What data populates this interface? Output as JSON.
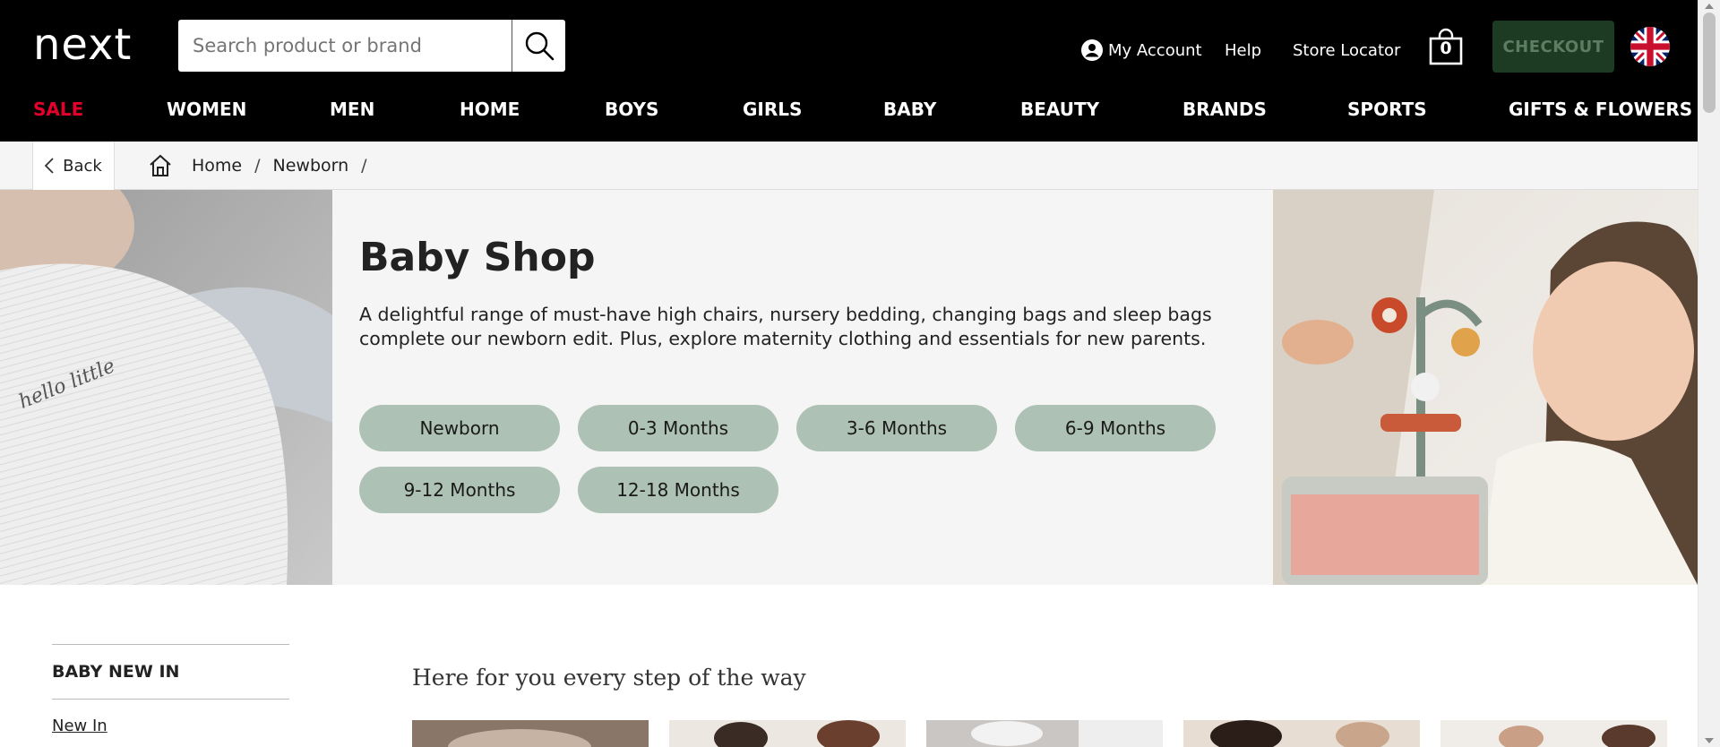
{
  "header": {
    "logo_text": "next",
    "search": {
      "placeholder": "Search product or brand",
      "value": ""
    },
    "account_label": "My Account",
    "help_label": "Help",
    "store_locator_label": "Store Locator",
    "bag_count": "0",
    "checkout_label": "CHECKOUT"
  },
  "nav": {
    "items": [
      {
        "label": "SALE"
      },
      {
        "label": "WOMEN"
      },
      {
        "label": "MEN"
      },
      {
        "label": "HOME"
      },
      {
        "label": "BOYS"
      },
      {
        "label": "GIRLS"
      },
      {
        "label": "BABY"
      },
      {
        "label": "BEAUTY"
      },
      {
        "label": "BRANDS"
      },
      {
        "label": "SPORTS"
      },
      {
        "label": "GIFTS & FLOWERS"
      }
    ]
  },
  "breadcrumb": {
    "back_label": "Back",
    "items": [
      "Home",
      "Newborn"
    ]
  },
  "hero": {
    "title": "Baby Shop",
    "description": "A delightful range of must-have high chairs, nursery bedding, changing bags and sleep bags complete our newborn edit. Plus, explore maternity clothing and essentials for new parents.",
    "chips": [
      "Newborn",
      "0-3 Months",
      "3-6 Months",
      "6-9 Months",
      "9-12 Months",
      "12-18 Months"
    ],
    "left_image_text": "hello little"
  },
  "sidebar": {
    "heading": "BABY NEW IN",
    "links": [
      "New In"
    ]
  },
  "main": {
    "section_title": "Here for you every step of the way"
  },
  "colors": {
    "header_bg": "#000000",
    "sale": "#e4002b",
    "checkout_bg": "#1d3b22",
    "chip_bg": "#adc1b4",
    "hero_bg": "#f5f5f5"
  },
  "icons": {
    "search": "search-icon",
    "account": "person-icon",
    "bag": "bag-icon",
    "flag": "uk-flag-icon",
    "back": "chevron-left-icon",
    "home": "home-icon"
  }
}
